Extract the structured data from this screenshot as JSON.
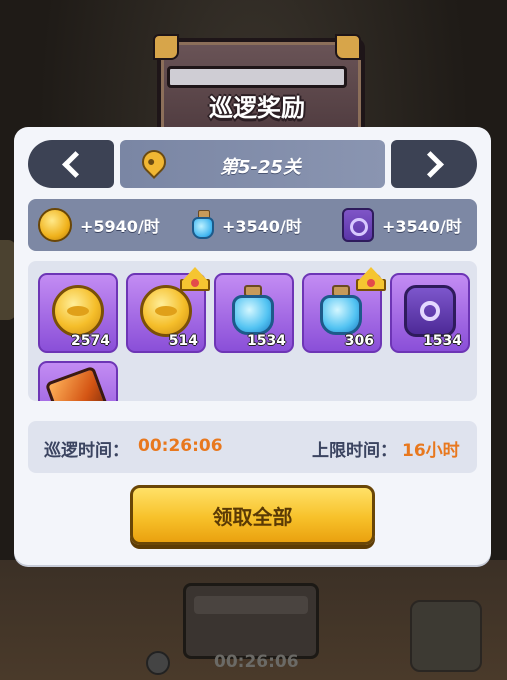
{
  "header": {
    "title": "巡逻奖励"
  },
  "stage": {
    "label": "第5-25关"
  },
  "rates": [
    {
      "icon": "gold-coin-icon",
      "value": "+5940/时"
    },
    {
      "icon": "blue-potion-icon",
      "value": "+3540/时"
    },
    {
      "icon": "purple-scroll-icon",
      "value": "+3540/时"
    }
  ],
  "rewards": [
    {
      "icon": "gold-coin-icon",
      "count": "2574",
      "crown": false
    },
    {
      "icon": "gold-coin-icon",
      "count": "514",
      "crown": true
    },
    {
      "icon": "blue-potion-icon",
      "count": "1534",
      "crown": false
    },
    {
      "icon": "blue-potion-icon",
      "count": "306",
      "crown": true
    },
    {
      "icon": "purple-scroll-icon",
      "count": "1534",
      "crown": false
    },
    {
      "icon": "orange-gem-icon",
      "count": "",
      "crown": false
    }
  ],
  "patrol_time": {
    "label": "巡逻时间：",
    "value": "00:26:06"
  },
  "limit_time": {
    "label": "上限时间：",
    "value": "16小时"
  },
  "claim_button": {
    "label": "领取全部"
  },
  "background": {
    "timer": "00:26:06"
  }
}
